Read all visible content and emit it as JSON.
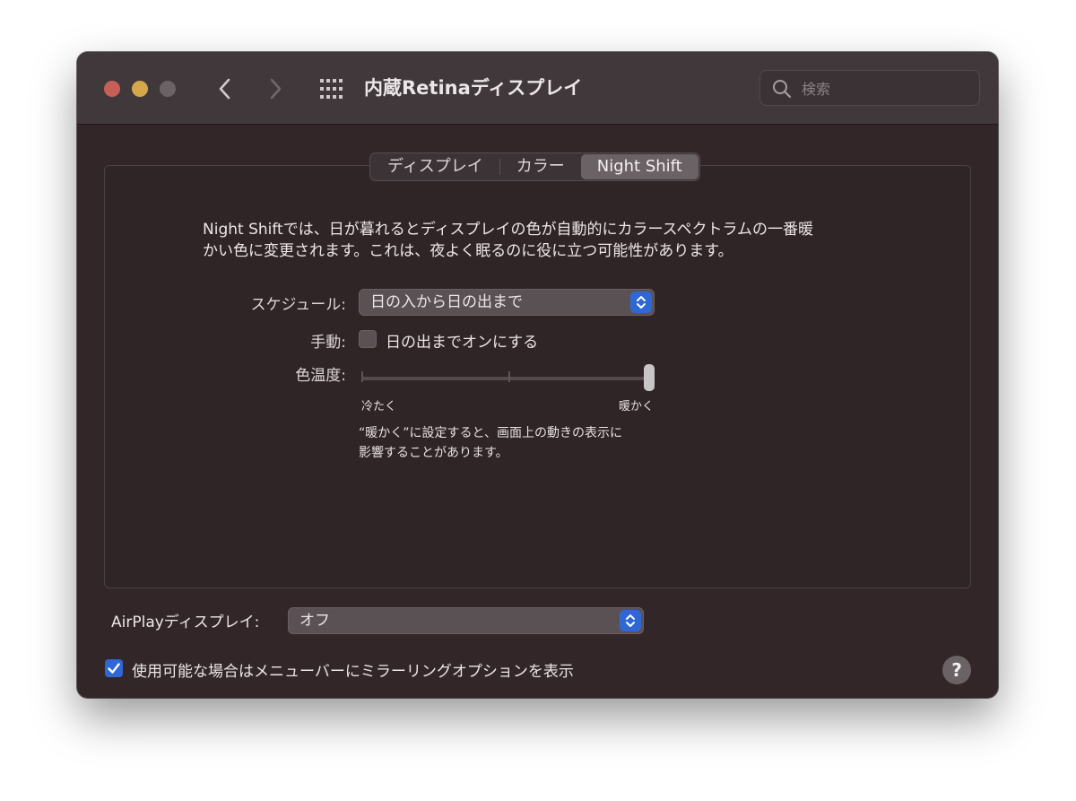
{
  "window": {
    "title": "内蔵Retinaディスプレイ",
    "search_placeholder": "検索"
  },
  "toolbar_icons": [
    "back-chevron-icon",
    "forward-chevron-icon",
    "grid-icon",
    "search-icon"
  ],
  "tabs": [
    {
      "label": "ディスプレイ",
      "selected": false
    },
    {
      "label": "カラー",
      "selected": false
    },
    {
      "label": "Night Shift",
      "selected": true
    }
  ],
  "night_shift": {
    "description_lines": [
      "Night Shiftでは、日が暮れるとディスプレイの色が自動的にカラースペクトラムの一番暖",
      "かい色に変更されます。これは、夜よく眠るのに役に立つ可能性があります。"
    ],
    "schedule_label": "スケジュール:",
    "schedule_value": "日の入から日の出まで",
    "manual_label": "手動:",
    "manual_checkbox_label": "日の出までオンにする",
    "manual_checked": false,
    "color_temp_label": "色温度:",
    "slider_min_label": "冷たく",
    "slider_max_label": "暖かく",
    "slider_value": 1.0,
    "note_lines": [
      "“暖かく”に設定すると、画面上の動きの表示に",
      "影響することがあります。"
    ]
  },
  "airplay": {
    "label": "AirPlayディスプレイ:",
    "value": "オフ"
  },
  "mirroring": {
    "label": "使用可能な場合はメニューバーにミラーリングオプションを表示",
    "checked": true
  },
  "help": {
    "label": "?"
  },
  "colors": {
    "accent": "#2f68d4",
    "window_bg": "#322628",
    "titlebar_bg": "#40383a",
    "close": "#c65f57",
    "minimize": "#d6a64a"
  }
}
